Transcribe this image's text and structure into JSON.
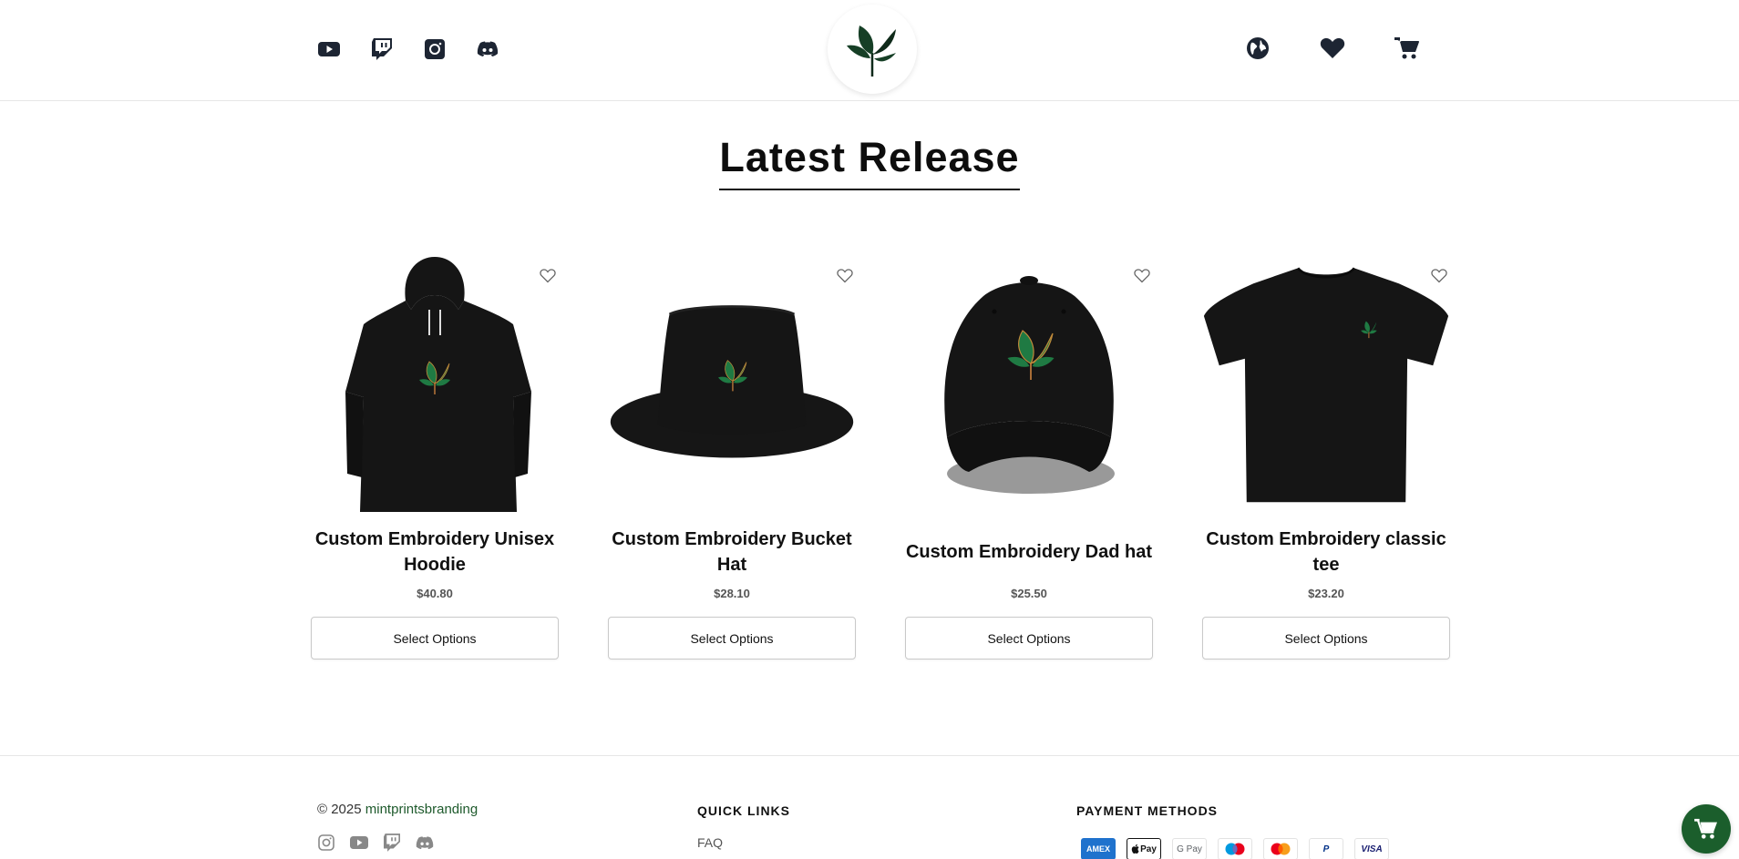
{
  "header": {
    "social_icons": [
      "youtube-icon",
      "twitch-icon",
      "instagram-icon",
      "discord-icon"
    ],
    "logo": "leaf-logo",
    "right_icons": [
      "globe-icon",
      "heart-icon",
      "cart-icon"
    ]
  },
  "section": {
    "title": "Latest Release"
  },
  "products": [
    {
      "name": "Custom Embroidery Unisex Hoodie",
      "price": "$40.80",
      "button": "Select Options",
      "kind": "hoodie"
    },
    {
      "name": "Custom Embroidery Bucket Hat",
      "price": "$28.10",
      "button": "Select Options",
      "kind": "bucket-hat"
    },
    {
      "name": "Custom Embroidery Dad hat",
      "price": "$25.50",
      "button": "Select Options",
      "kind": "dad-hat"
    },
    {
      "name": "Custom Embroidery classic tee",
      "price": "$23.20",
      "button": "Select Options",
      "kind": "tee"
    }
  ],
  "footer": {
    "copyright_prefix": "© 2025",
    "brand": "mintprintsbranding",
    "quick_links_title": "QUICK LINKS",
    "quick_links": [
      "FAQ"
    ],
    "payment_title": "PAYMENT METHODS",
    "payment_methods": [
      {
        "label": "AMEX",
        "kind": "amex"
      },
      {
        "label": "Pay",
        "kind": "apple"
      },
      {
        "label": "G Pay",
        "kind": "gpay"
      },
      {
        "label": "",
        "kind": "maestro"
      },
      {
        "label": "",
        "kind": "mastercard"
      },
      {
        "label": "P",
        "kind": "paypal"
      },
      {
        "label": "VISA",
        "kind": "visa"
      }
    ]
  },
  "colors": {
    "brand_green": "#1b5e2c",
    "leaf_green": "#1f7a43",
    "garment_black": "#151515"
  }
}
